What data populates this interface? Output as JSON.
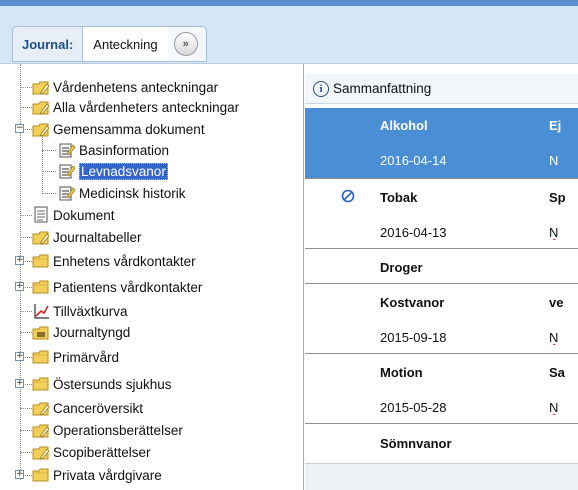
{
  "tabs": {
    "journal_label": "Journal:",
    "note_label": "Anteckning",
    "more_icon": "double-chevron-right-icon"
  },
  "tree": {
    "items": [
      {
        "label": "Vårdenhetens anteckningar",
        "icon": "folder-pen-icon"
      },
      {
        "label": "Alla vårdenheters anteckningar",
        "icon": "folder-pen-icon"
      },
      {
        "label": "Gemensamma dokument",
        "icon": "folder-pen-icon",
        "expander": "−"
      },
      {
        "label": "Basinformation",
        "icon": "document-pen-icon"
      },
      {
        "label": "Levnadsvanor",
        "icon": "document-pen-icon",
        "selected": true
      },
      {
        "label": "Medicinsk historik",
        "icon": "document-pen-icon"
      },
      {
        "label": "Dokument",
        "icon": "document-icon"
      },
      {
        "label": "Journaltabeller",
        "icon": "folder-pen-icon"
      },
      {
        "label": "Enhetens vårdkontakter",
        "icon": "folder-icon",
        "expander": "+"
      },
      {
        "label": "Patientens vårdkontakter",
        "icon": "folder-icon",
        "expander": "+"
      },
      {
        "label": "Tillväxtkurva",
        "icon": "growth-chart-icon"
      },
      {
        "label": "Journaltyngd",
        "icon": "folder-weight-icon"
      },
      {
        "label": "Primärvård",
        "icon": "folder-icon",
        "expander": "+"
      },
      {
        "label": "Östersunds sjukhus",
        "icon": "folder-icon",
        "expander": "+"
      },
      {
        "label": "Canceröversikt",
        "icon": "folder-pen-icon"
      },
      {
        "label": "Operationsberättelser",
        "icon": "folder-pen-icon"
      },
      {
        "label": "Scopiberättelser",
        "icon": "folder-pen-icon"
      },
      {
        "label": "Privata vårdgivare",
        "icon": "folder-icon",
        "expander": "+"
      }
    ]
  },
  "detail": {
    "summary_label": "Sammanfattning",
    "rows": [
      {
        "name": "Alkohol",
        "value": "Ej",
        "bold": true,
        "selected": true,
        "icon": ""
      },
      {
        "name": "2016-04-14",
        "value": "N",
        "bold": false,
        "selected": true,
        "icon": ""
      },
      {
        "name": "Tobak",
        "value": "Sp",
        "bold": true,
        "selected": false,
        "icon": "prohibited-icon"
      },
      {
        "name": "2016-04-13",
        "value": "N",
        "bold": false,
        "selected": false,
        "icon": "",
        "squiggle": true
      },
      {
        "name": "Droger",
        "value": "",
        "bold": true,
        "selected": false,
        "icon": ""
      },
      {
        "name": "Kostvanor",
        "value": "ve",
        "bold": true,
        "selected": false,
        "icon": ""
      },
      {
        "name": "2015-09-18",
        "value": "N",
        "bold": false,
        "selected": false,
        "icon": "",
        "squiggle": true
      },
      {
        "name": "Motion",
        "value": "Sa",
        "bold": true,
        "selected": false,
        "icon": ""
      },
      {
        "name": "2015-05-28",
        "value": "N",
        "bold": false,
        "selected": false,
        "icon": "",
        "squiggle": true
      },
      {
        "name": "Sömnvanor",
        "value": "",
        "bold": true,
        "selected": false,
        "icon": ""
      }
    ]
  },
  "colors": {
    "selection_blue": "#4a8fd6",
    "tab_bar": "#d5e6f7",
    "folder_yellow": "#f3cf5a",
    "prohibited_blue": "#1f5fd0"
  }
}
